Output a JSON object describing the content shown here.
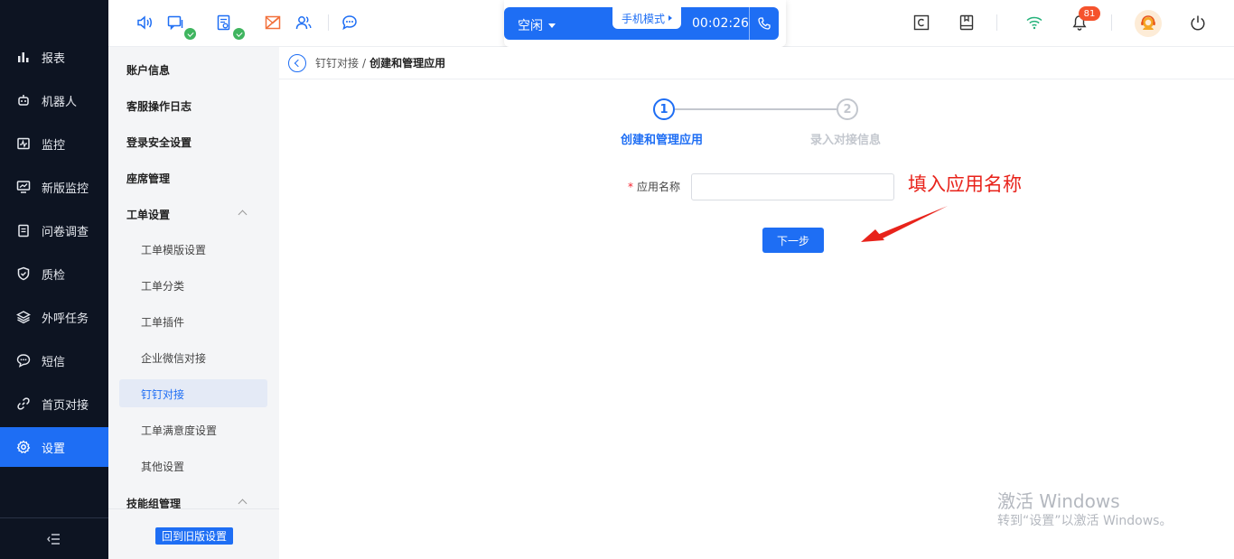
{
  "sidebar": {
    "items": [
      {
        "label": "报表",
        "icon": "bar-chart-icon",
        "active": false
      },
      {
        "label": "机器人",
        "icon": "robot-icon",
        "active": false
      },
      {
        "label": "监控",
        "icon": "monitor-pulse-icon",
        "active": false
      },
      {
        "label": "新版监控",
        "icon": "desktop-chart-icon",
        "active": false
      },
      {
        "label": "问卷调查",
        "icon": "clipboard-icon",
        "active": false
      },
      {
        "label": "质检",
        "icon": "shield-check-icon",
        "active": false
      },
      {
        "label": "外呼任务",
        "icon": "layers-icon",
        "active": false
      },
      {
        "label": "短信",
        "icon": "chat-bubble-icon",
        "active": false
      },
      {
        "label": "首页对接",
        "icon": "link-icon",
        "active": false
      },
      {
        "label": "设置",
        "icon": "gear-icon",
        "active": true
      }
    ],
    "collapse_icon": "collapse-menu-icon"
  },
  "topbar": {
    "status_label": "空闲",
    "mode_label": "手机模式",
    "timer": "00:02:26",
    "notification_count": "81",
    "colors": {
      "accent": "#1e6ef4",
      "ok": "#3fb55f",
      "alert": "#f5532d",
      "wifi": "#23b27a"
    }
  },
  "submenu": {
    "account_info": "账户信息",
    "operation_log": "客服操作日志",
    "login_security": "登录安全设置",
    "seat_management": "座席管理",
    "ticket_settings": "工单设置",
    "ticket_children": [
      "工单模版设置",
      "工单分类",
      "工单插件",
      "企业微信对接",
      "钉钉对接",
      "工单满意度设置",
      "其他设置"
    ],
    "skill_group": "技能组管理",
    "old_version_button": "回到旧版设置"
  },
  "breadcrumb": {
    "parent": "钉钉对接",
    "separator": "/",
    "current": "创建和管理应用"
  },
  "steps": [
    {
      "number": "1",
      "label": "创建和管理应用",
      "active": true
    },
    {
      "number": "2",
      "label": "录入对接信息",
      "active": false
    }
  ],
  "form": {
    "required_mark": "*",
    "app_name_label": "应用名称",
    "app_name_value": "",
    "next_button": "下一步"
  },
  "annotation": {
    "text": "填入应用名称",
    "color": "#e8231b"
  },
  "watermark": {
    "title": "激活 Windows",
    "subtitle": "转到“设置”以激活 Windows。"
  }
}
